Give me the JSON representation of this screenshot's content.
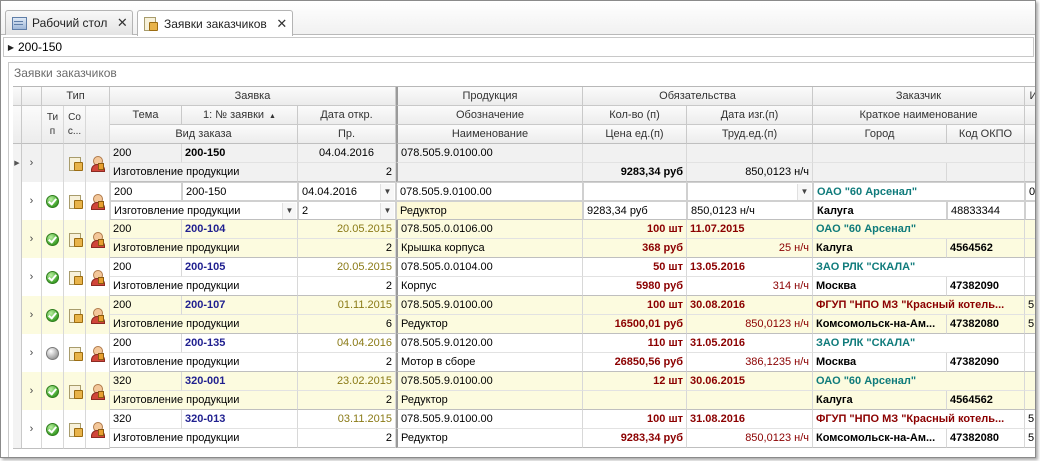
{
  "tabs": [
    {
      "label": "Рабочий стол",
      "active": false,
      "close": "✕"
    },
    {
      "label": "Заявки заказчиков",
      "active": true,
      "close": "✕"
    }
  ],
  "findbar": {
    "value": "200-150"
  },
  "panel": {
    "caption": "Заявки заказчиков"
  },
  "headers": {
    "band_type": "Тип",
    "band_order": "Заявка",
    "band_product": "Продукция",
    "band_obligations": "Обязательства",
    "band_customer": "Заказчик",
    "band_extra": "И",
    "col_tip": "Ти п",
    "col_sost": "Со с...",
    "col_tema": "Тема",
    "col_num": "1: № заявки",
    "col_date": "Дата откр.",
    "col_vid": "Вид заказа",
    "col_pr": "Пр.",
    "col_oboz": "Обозначение",
    "col_naim": "Наименование",
    "col_kol": "Кол-во (п)",
    "col_dateizg": "Дата изг.(п)",
    "col_price": "Цена ед.(п)",
    "col_trud": "Труд.ед.(п)",
    "col_short": "Краткое наименование",
    "col_city": "Город",
    "col_okpo": "Код ОКПО"
  },
  "rows": [
    {
      "style": "grey",
      "status": "",
      "tema": "200",
      "num": "200-150",
      "date": "04.04.2016",
      "vid": "Изготовление продукции",
      "pr": "2",
      "oboz": "078.505.9.0100.00",
      "naim": "",
      "kol": "",
      "dateizg": "",
      "price": "9283,34 руб",
      "trud": "850,0123 н/ч",
      "short": "",
      "city": "",
      "okpo": "",
      "extra1": "",
      "extra2": ""
    },
    {
      "style": "focus",
      "status": "check",
      "tema": "200",
      "num": "200-150",
      "date": "04.04.2016",
      "vid": "Изготовление продукции",
      "pr": "2",
      "oboz": "078.505.9.0100.00",
      "naim": "Редуктор",
      "kol": "",
      "dateizg": "",
      "price": "9283,34 руб",
      "trud": "850,0123 н/ч",
      "short": "ОАО \"60 Арсенал\"",
      "city": "Калуга",
      "okpo": "48833344",
      "extra1": "0",
      "extra2": ""
    },
    {
      "style": "yellow",
      "status": "check",
      "tema": "200",
      "num": "200-104",
      "date": "20.05.2015",
      "vid": "Изготовление продукции",
      "pr": "2",
      "oboz": "078.505.0.0106.00",
      "naim": "Крышка корпуса",
      "kol": "100 шт",
      "dateizg": "11.07.2015",
      "price": "368 руб",
      "trud": "25 н/ч",
      "short": "ОАО \"60 Арсенал\"",
      "city": "Калуга",
      "okpo": "4564562",
      "extra1": "",
      "extra2": ""
    },
    {
      "style": "white",
      "status": "check",
      "tema": "200",
      "num": "200-105",
      "date": "20.05.2015",
      "vid": "Изготовление продукции",
      "pr": "2",
      "oboz": "078.505.0.0104.00",
      "naim": "Корпус",
      "kol": "50 шт",
      "dateizg": "13.05.2016",
      "price": "5980 руб",
      "trud": "314 н/ч",
      "short": "ЗАО РЛК \"СКАЛА\"",
      "city": "Москва",
      "okpo": "47382090",
      "extra1": "",
      "extra2": ""
    },
    {
      "style": "yellow",
      "status": "check",
      "tema": "200",
      "num": "200-107",
      "date": "01.11.2015",
      "vid": "Изготовление продукции",
      "pr": "6",
      "oboz": "078.505.9.0100.00",
      "naim": "Редуктор",
      "kol": "100 шт",
      "dateizg": "30.08.2016",
      "price": "16500,01 руб",
      "trud": "850,0123 н/ч",
      "short": "ФГУП \"НПО МЗ \"Красный котель...",
      "city": "Комсомольск-на-Ам...",
      "okpo": "47382080",
      "extra1": "5",
      "extra2": "5"
    },
    {
      "style": "white",
      "status": "grey",
      "tema": "200",
      "num": "200-135",
      "date": "04.04.2016",
      "vid": "Изготовление продукции",
      "pr": "2",
      "oboz": "078.505.9.0120.00",
      "naim": "Мотор в сборе",
      "kol": "110 шт",
      "dateizg": "31.05.2016",
      "price": "26850,56 руб",
      "trud": "386,1235 н/ч",
      "short": "ЗАО РЛК \"СКАЛА\"",
      "city": "Москва",
      "okpo": "47382090",
      "extra1": "",
      "extra2": ""
    },
    {
      "style": "yellow",
      "status": "check",
      "tema": "320",
      "num": "320-001",
      "date": "23.02.2015",
      "vid": "Изготовление продукции",
      "pr": "2",
      "oboz": "078.505.9.0100.00",
      "naim": "Редуктор",
      "kol": "12 шт",
      "dateizg": "30.06.2015",
      "price": "",
      "trud": "",
      "short": "ОАО \"60 Арсенал\"",
      "city": "Калуга",
      "okpo": "4564562",
      "extra1": "",
      "extra2": ""
    },
    {
      "style": "white",
      "status": "check",
      "tema": "320",
      "num": "320-013",
      "date": "03.11.2015",
      "vid": "Изготовление продукции",
      "pr": "2",
      "oboz": "078.505.9.0100.00",
      "naim": "Редуктор",
      "kol": "100 шт",
      "dateizg": "31.08.2016",
      "price": "9283,34 руб",
      "trud": "850,0123 н/ч",
      "short": "ФГУП \"НПО МЗ \"Красный котель...",
      "city": "Комсомольск-на-Ам...",
      "okpo": "47382080",
      "extra1": "5",
      "extra2": "5"
    }
  ],
  "colors": {
    "accent_teal": "#0f7b7b",
    "number_navy": "#1f1f8f",
    "date_olive": "#8a7a16",
    "value_darkred": "#8b0000",
    "row_yellow": "#fcfbdf"
  }
}
